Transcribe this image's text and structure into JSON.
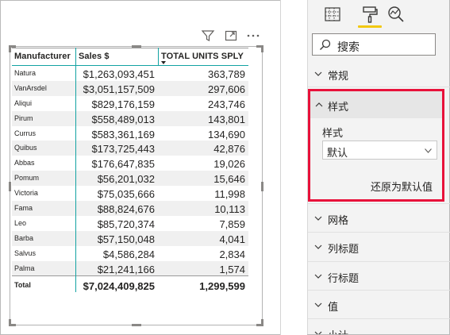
{
  "visual_header": {
    "icons": [
      "filter-icon",
      "focus-mode-icon",
      "more-options-icon"
    ]
  },
  "table": {
    "columns": [
      "Manufacturer",
      "Sales $",
      "TOTAL UNITS SPLY"
    ],
    "rows": [
      {
        "manufacturer": "Natura",
        "sales": "$1,263,093,451",
        "units": "363,789"
      },
      {
        "manufacturer": "VanArsdel",
        "sales": "$3,051,157,509",
        "units": "297,606"
      },
      {
        "manufacturer": "Aliqui",
        "sales": "$829,176,159",
        "units": "243,746"
      },
      {
        "manufacturer": "Pirum",
        "sales": "$558,489,013",
        "units": "143,801"
      },
      {
        "manufacturer": "Currus",
        "sales": "$583,361,169",
        "units": "134,690"
      },
      {
        "manufacturer": "Quibus",
        "sales": "$173,725,443",
        "units": "42,876"
      },
      {
        "manufacturer": "Abbas",
        "sales": "$176,647,835",
        "units": "19,026"
      },
      {
        "manufacturer": "Pomum",
        "sales": "$56,201,032",
        "units": "15,646"
      },
      {
        "manufacturer": "Victoria",
        "sales": "$75,035,666",
        "units": "11,998"
      },
      {
        "manufacturer": "Fama",
        "sales": "$88,824,676",
        "units": "10,113"
      },
      {
        "manufacturer": "Leo",
        "sales": "$85,720,374",
        "units": "7,859"
      },
      {
        "manufacturer": "Barba",
        "sales": "$57,150,048",
        "units": "4,041"
      },
      {
        "manufacturer": "Salvus",
        "sales": "$4,586,284",
        "units": "2,834"
      },
      {
        "manufacturer": "Palma",
        "sales": "$21,241,166",
        "units": "1,574"
      }
    ],
    "total": {
      "label": "Total",
      "sales": "$7,024,409,825",
      "units": "1,299,599"
    },
    "sorted_column": "TOTAL UNITS SPLY",
    "header_underline_color": "#13a3a3"
  },
  "pane": {
    "tabs": [
      "fields-icon",
      "format-paint-roller-icon",
      "analytics-icon"
    ],
    "active_tab": "format-paint-roller-icon",
    "active_tab_color": "#f2c811",
    "search_placeholder": "搜索",
    "sections": {
      "general": "常规",
      "style": "样式",
      "grid": "网格",
      "column_headers": "列标题",
      "row_headers": "行标题",
      "values": "值",
      "subtotals": "小计"
    },
    "style_panel": {
      "field_label": "样式",
      "selected_value": "默认",
      "reset_label": "还原为默认值",
      "highlight_color": "#e8113a"
    }
  }
}
